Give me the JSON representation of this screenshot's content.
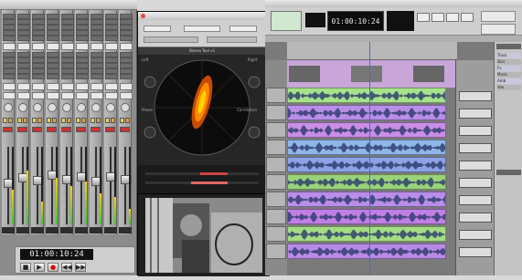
{
  "mixer": {
    "strip_count": 9,
    "selector_labels": [
      "",
      "",
      "",
      "",
      "",
      "",
      "",
      "",
      ""
    ],
    "fader_levels": [
      0.55,
      0.62,
      0.58,
      0.66,
      0.6,
      0.64,
      0.57,
      0.63,
      0.6
    ],
    "meter_levels": [
      0.45,
      0.7,
      0.3,
      0.6,
      0.5,
      0.55,
      0.4,
      0.35,
      0.2
    ]
  },
  "transport": {
    "counter": "01:00:10:24",
    "buttons": [
      "■",
      "▶",
      "●",
      "◀◀",
      "▶▶"
    ]
  },
  "plugin": {
    "title": "Stereo Tool 1",
    "header_label": "Stereo Tool v1",
    "labels": [
      "Left",
      "Right",
      "Phase",
      "Correlation"
    ]
  },
  "edit_toolbar": {
    "counter": "01:00:10:24"
  },
  "tracks": {
    "colors": [
      "#a6e28a",
      "#b88ee8",
      "#c98ee6",
      "#8fb6e8",
      "#8ea2e6",
      "#9ad27a",
      "#b98ee8",
      "#c07fe4",
      "#a5dc82",
      "#b98ae6",
      "#c68fe2"
    ],
    "accent": "#3c6fd0"
  },
  "track_list": {
    "items": [
      "Track",
      "Dial",
      "Fx",
      "Music",
      "Amb",
      "Vox"
    ]
  }
}
